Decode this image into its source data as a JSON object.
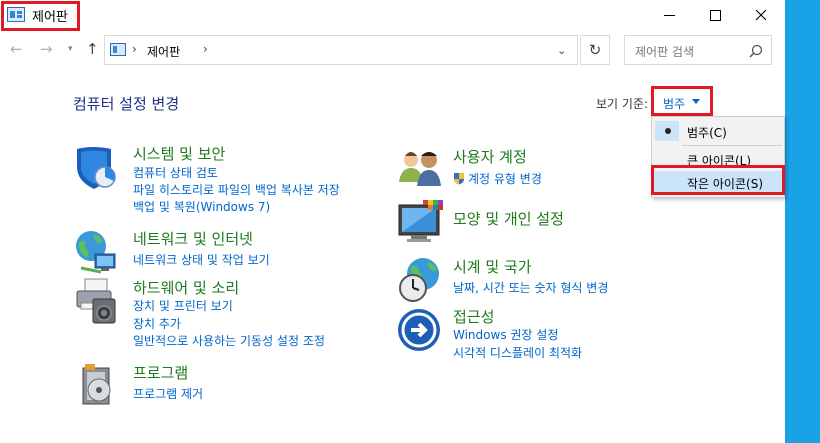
{
  "window": {
    "title": "제어판"
  },
  "address": {
    "breadcrumb": "제어판",
    "search_placeholder": "제어판 검색"
  },
  "header": {
    "title": "컴퓨터 설정 변경",
    "view_label": "보기 기준:",
    "view_value": "범주"
  },
  "view_menu": {
    "items": [
      {
        "label": "범주(C)",
        "selected": true
      },
      {
        "label": "큰 아이콘(L)",
        "selected": false
      },
      {
        "label": "작은 아이콘(S)",
        "selected": false,
        "highlighted": true
      }
    ]
  },
  "categories": {
    "system": {
      "title": "시스템 및 보안",
      "links": [
        "컴퓨터 상태 검토",
        "파일 히스토리로 파일의 백업 복사본 저장",
        "백업 및 복원(Windows 7)"
      ]
    },
    "network": {
      "title": "네트워크 및 인터넷",
      "links": [
        "네트워크 상태 및 작업 보기"
      ]
    },
    "hardware": {
      "title": "하드웨어 및 소리",
      "links": [
        "장치 및 프린터 보기",
        "장치 추가",
        "일반적으로 사용하는 기동성 설정 조정"
      ]
    },
    "programs": {
      "title": "프로그램",
      "links": [
        "프로그램 제거"
      ]
    },
    "users": {
      "title": "사용자 계정",
      "links": [
        "계정 유형 변경"
      ]
    },
    "appearance": {
      "title": "모양 및 개인 설정",
      "links": []
    },
    "clock": {
      "title": "시계 및 국가",
      "links": [
        "날짜, 시간 또는 숫자 형식 변경"
      ]
    },
    "access": {
      "title": "접근성",
      "links": [
        "Windows 권장 설정",
        "시각적 디스플레이 최적화"
      ]
    }
  },
  "colors": {
    "accent_strip": "#1aa2e6",
    "highlight_border": "#e01a25",
    "category_title": "#1e7a1e",
    "link": "#0066cc",
    "heading": "#1e3287"
  }
}
